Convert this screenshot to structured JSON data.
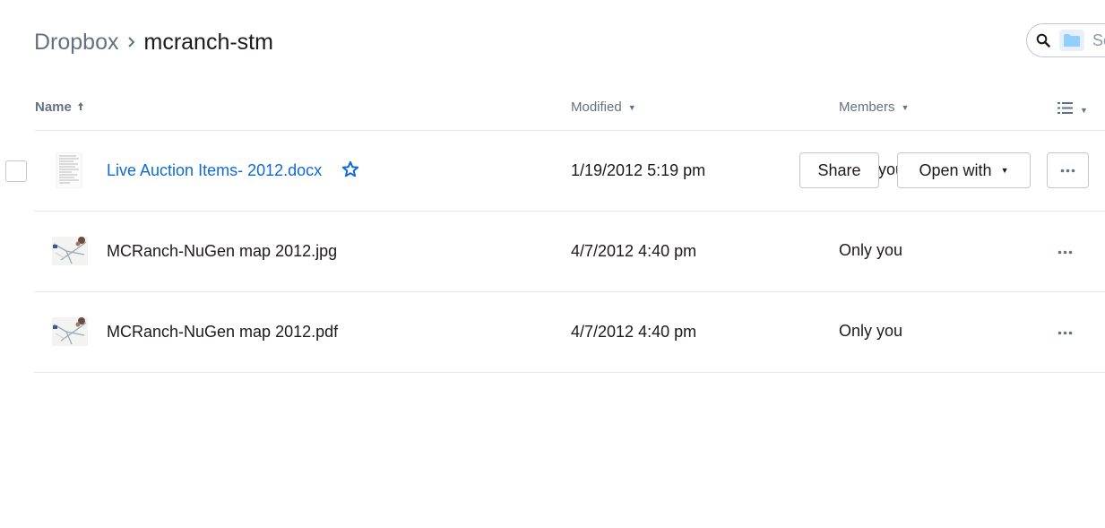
{
  "breadcrumb": {
    "root": "Dropbox",
    "current": "mcranch-stm"
  },
  "search": {
    "placeholder": "Se"
  },
  "columns": {
    "name": "Name",
    "modified": "Modified",
    "members": "Members"
  },
  "files": [
    {
      "name": "Live Auction Items- 2012.docx",
      "modified": "1/19/2012 5:19 pm",
      "members": "you",
      "thumbnail": "document-thumbnail",
      "hovered": true,
      "actions": {
        "share": "Share",
        "open_with": "Open with"
      }
    },
    {
      "name": "MCRanch-NuGen map 2012.jpg",
      "modified": "4/7/2012 4:40 pm",
      "members": "Only you",
      "thumbnail": "map-thumbnail"
    },
    {
      "name": "MCRanch-NuGen map 2012.pdf",
      "modified": "4/7/2012 4:40 pm",
      "members": "Only you",
      "thumbnail": "map-thumbnail"
    }
  ],
  "colors": {
    "link": "#0f6ad6",
    "muted": "#637282",
    "text": "#1e1919",
    "border": "#c1c7cd",
    "divider": "#e6e8eb"
  }
}
